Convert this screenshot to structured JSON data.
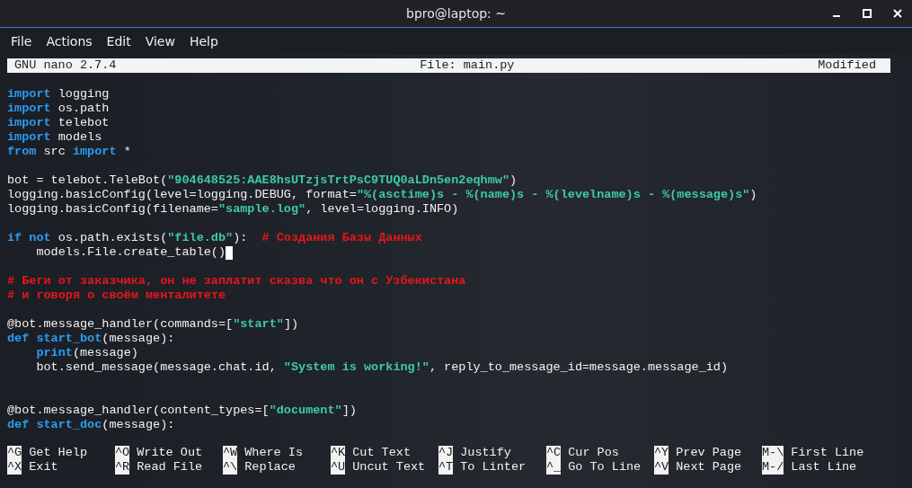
{
  "window": {
    "title": "bpro@laptop: ~"
  },
  "menu": [
    "File",
    "Actions",
    "Edit",
    "View",
    "Help"
  ],
  "nano_header": {
    "version": "GNU nano 2.7.4",
    "file": "File: main.py",
    "status": "Modified"
  },
  "lines": [
    {
      "kind": "code",
      "segments": [
        {
          "kind": "keyword",
          "text": "import"
        },
        {
          "kind": "plain",
          "text": " logging"
        }
      ]
    },
    {
      "kind": "code",
      "segments": [
        {
          "kind": "keyword",
          "text": "import"
        },
        {
          "kind": "plain",
          "text": " os.path"
        }
      ]
    },
    {
      "kind": "code",
      "segments": [
        {
          "kind": "keyword",
          "text": "import"
        },
        {
          "kind": "plain",
          "text": " telebot"
        }
      ]
    },
    {
      "kind": "code",
      "segments": [
        {
          "kind": "keyword",
          "text": "import"
        },
        {
          "kind": "plain",
          "text": " models"
        }
      ]
    },
    {
      "kind": "code",
      "segments": [
        {
          "kind": "keyword",
          "text": "from"
        },
        {
          "kind": "plain",
          "text": " src "
        },
        {
          "kind": "keyword",
          "text": "import"
        },
        {
          "kind": "plain",
          "text": " *"
        }
      ]
    },
    {
      "kind": "blank"
    },
    {
      "kind": "code",
      "segments": [
        {
          "kind": "plain",
          "text": "bot = telebot.TeleBot("
        },
        {
          "kind": "string",
          "text": "\"904648525:AAE8hsUTzjsTrtPsC9TUQ0aLDn5en2eqhmw\""
        },
        {
          "kind": "plain",
          "text": ")"
        }
      ]
    },
    {
      "kind": "code",
      "segments": [
        {
          "kind": "plain",
          "text": "logging.basicConfig(level=logging.DEBUG, format="
        },
        {
          "kind": "string",
          "text": "\"%(asctime)s - %(name)s - %(levelname)s - %(message)s\""
        },
        {
          "kind": "plain",
          "text": ")"
        }
      ]
    },
    {
      "kind": "code",
      "segments": [
        {
          "kind": "plain",
          "text": "logging.basicConfig(filename="
        },
        {
          "kind": "string",
          "text": "\"sample.log\""
        },
        {
          "kind": "plain",
          "text": ", level=logging.INFO)"
        }
      ]
    },
    {
      "kind": "blank"
    },
    {
      "kind": "code",
      "segments": [
        {
          "kind": "keyword",
          "text": "if not"
        },
        {
          "kind": "plain",
          "text": " os.path.exists("
        },
        {
          "kind": "string",
          "text": "\"file.db\""
        },
        {
          "kind": "plain",
          "text": "):  "
        },
        {
          "kind": "comment",
          "text": "# Создания Базы Данных"
        }
      ]
    },
    {
      "kind": "code",
      "cursor": true,
      "segments": [
        {
          "kind": "plain",
          "text": "    models.File.create_table()"
        }
      ]
    },
    {
      "kind": "blank"
    },
    {
      "kind": "code",
      "segments": [
        {
          "kind": "comment",
          "text": "# Беги от заказчика, он не заплатит сказва что он с Узбекистана"
        }
      ]
    },
    {
      "kind": "code",
      "segments": [
        {
          "kind": "comment",
          "text": "# и говоря о своём менталитете"
        }
      ]
    },
    {
      "kind": "blank"
    },
    {
      "kind": "code",
      "segments": [
        {
          "kind": "plain",
          "text": "@bot.message_handler(commands=["
        },
        {
          "kind": "string",
          "text": "\"start\""
        },
        {
          "kind": "plain",
          "text": "])"
        }
      ]
    },
    {
      "kind": "code",
      "segments": [
        {
          "kind": "keyword",
          "text": "def start_bot"
        },
        {
          "kind": "plain",
          "text": "(message):"
        }
      ]
    },
    {
      "kind": "code",
      "segments": [
        {
          "kind": "keyword",
          "text": "    print"
        },
        {
          "kind": "plain",
          "text": "(message)"
        }
      ]
    },
    {
      "kind": "code",
      "segments": [
        {
          "kind": "plain",
          "text": "    bot.send_message(message.chat.id, "
        },
        {
          "kind": "string",
          "text": "\"System is working!\""
        },
        {
          "kind": "plain",
          "text": ", reply_to_message_id=message.message_id)"
        }
      ]
    },
    {
      "kind": "blank"
    },
    {
      "kind": "blank"
    },
    {
      "kind": "code",
      "segments": [
        {
          "kind": "plain",
          "text": "@bot.message_handler(content_types=["
        },
        {
          "kind": "string",
          "text": "\"document\""
        },
        {
          "kind": "plain",
          "text": "])"
        }
      ]
    },
    {
      "kind": "code",
      "segments": [
        {
          "kind": "keyword",
          "text": "def start_doc"
        },
        {
          "kind": "plain",
          "text": "(message):"
        }
      ]
    }
  ],
  "shortcuts": [
    [
      {
        "key": "^G",
        "label": "Get Help"
      },
      {
        "key": "^O",
        "label": "Write Out"
      },
      {
        "key": "^W",
        "label": "Where Is"
      },
      {
        "key": "^K",
        "label": "Cut Text"
      },
      {
        "key": "^J",
        "label": "Justify"
      },
      {
        "key": "^C",
        "label": "Cur Pos"
      },
      {
        "key": "^Y",
        "label": "Prev Page"
      },
      {
        "key": "M-\\",
        "label": "First Line"
      }
    ],
    [
      {
        "key": "^X",
        "label": "Exit"
      },
      {
        "key": "^R",
        "label": "Read File"
      },
      {
        "key": "^\\",
        "label": "Replace"
      },
      {
        "key": "^U",
        "label": "Uncut Text"
      },
      {
        "key": "^T",
        "label": "To Linter"
      },
      {
        "key": "^_",
        "label": "Go To Line"
      },
      {
        "key": "^V",
        "label": "Next Page"
      },
      {
        "key": "M-/",
        "label": "Last Line"
      }
    ]
  ]
}
